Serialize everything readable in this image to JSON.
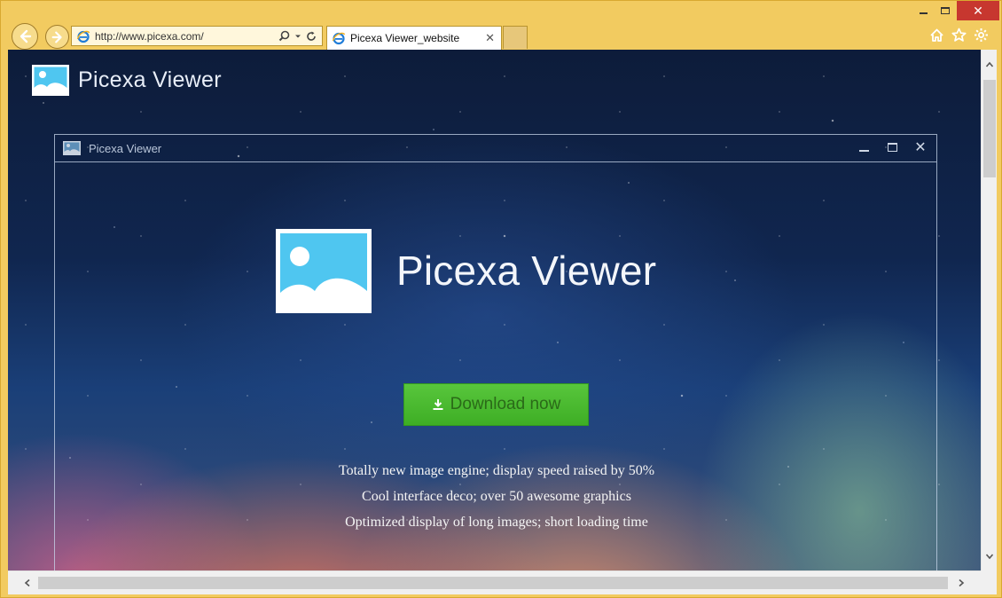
{
  "browser": {
    "address": {
      "url": "http://www.picexa.com/"
    },
    "tab": {
      "title": "Picexa Viewer_website"
    },
    "window_controls": {
      "close_glyph": "✕"
    },
    "icons": {
      "back": "arrow-left-icon",
      "forward": "arrow-right-icon",
      "search": "search-icon",
      "dropdown": "chevron-down-icon",
      "refresh": "refresh-icon",
      "home": "home-icon",
      "favorites": "star-icon",
      "settings": "gear-icon",
      "tab_close": "close-icon"
    },
    "colors": {
      "frame": "#f2cb60",
      "close_button": "#c7372f"
    }
  },
  "page": {
    "site_name": "Picexa Viewer",
    "inner_window": {
      "title": "Picexa Viewer",
      "close_glyph": "✕"
    },
    "product_name": "Picexa Viewer",
    "download_button": {
      "label": "Download now",
      "color": "#46b52c"
    },
    "features": [
      "Totally new image engine; display speed raised by 50%",
      "Cool interface deco; over 50 awesome graphics",
      "Optimized display of long images; short loading time"
    ]
  }
}
